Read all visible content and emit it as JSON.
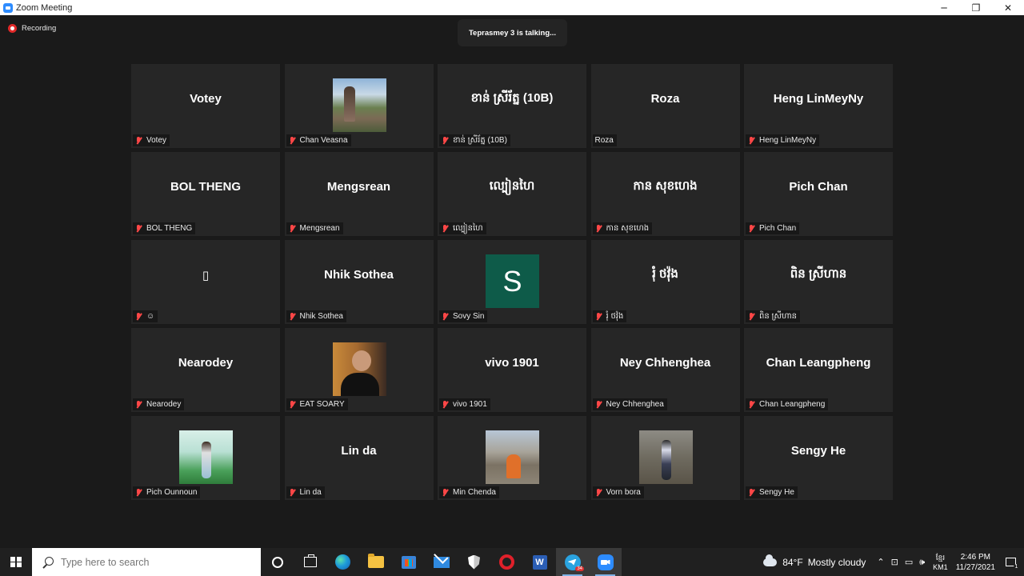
{
  "window": {
    "title": "Zoom Meeting",
    "minimize": "─",
    "restore": "❐",
    "close": "✕"
  },
  "meeting": {
    "recording_label": "Recording",
    "talking_indicator": "Teprasmey 3 is talking..."
  },
  "participants": [
    {
      "display": "Votey",
      "label": "Votey",
      "muted": true,
      "tile": "name"
    },
    {
      "display": "",
      "label": "Chan Veasna",
      "muted": true,
      "tile": "photo-1"
    },
    {
      "display": "ខាន់ ស្រីរ័ត្ន (10B)",
      "label": "ខាន់ ស្រីរ័ត្ន (10B)",
      "muted": true,
      "tile": "name"
    },
    {
      "display": "Roza",
      "label": "Roza",
      "muted": false,
      "tile": "name"
    },
    {
      "display": "Heng LinMeyNy",
      "label": "Heng LinMeyNy",
      "muted": true,
      "tile": "name"
    },
    {
      "display": "BOL THENG",
      "label": "BOL THENG",
      "muted": true,
      "tile": "name"
    },
    {
      "display": "Mengsrean",
      "label": "Mengsrean",
      "muted": true,
      "tile": "name"
    },
    {
      "display": "ល្បៀនហៃ",
      "label": "ល្បៀនហៃ",
      "muted": true,
      "tile": "name"
    },
    {
      "display": "កាន សុខហេង",
      "label": "កាន សុខហេង",
      "muted": true,
      "tile": "name"
    },
    {
      "display": "Pich Chan",
      "label": "Pich Chan",
      "muted": true,
      "tile": "name"
    },
    {
      "display": "▯",
      "label": "☺",
      "muted": true,
      "tile": "name"
    },
    {
      "display": "Nhik Sothea",
      "label": "Nhik Sothea",
      "muted": true,
      "tile": "name"
    },
    {
      "display": "S",
      "label": "Sovy Sin",
      "muted": true,
      "tile": "initial"
    },
    {
      "display": "រុំ ថវ៉ុង",
      "label": "រុំ ថវ៉ុង",
      "muted": true,
      "tile": "name"
    },
    {
      "display": "ពិន ស្រីហាន",
      "label": "ពិន ស្រីហាន",
      "muted": true,
      "tile": "name"
    },
    {
      "display": "Nearodey",
      "label": "Nearodey",
      "muted": true,
      "tile": "name"
    },
    {
      "display": "",
      "label": "EAT SOARY",
      "muted": true,
      "tile": "photo-2"
    },
    {
      "display": "vivo 1901",
      "label": "vivo 1901",
      "muted": true,
      "tile": "name"
    },
    {
      "display": "Ney Chhenghea",
      "label": "Ney Chhenghea",
      "muted": true,
      "tile": "name"
    },
    {
      "display": "Chan Leangpheng",
      "label": "Chan Leangpheng",
      "muted": true,
      "tile": "name"
    },
    {
      "display": "",
      "label": "Pich Ounnoun",
      "muted": true,
      "tile": "photo-3"
    },
    {
      "display": "Lin da",
      "label": "Lin da",
      "muted": true,
      "tile": "name"
    },
    {
      "display": "",
      "label": "Min Chenda",
      "muted": true,
      "tile": "photo-4"
    },
    {
      "display": "",
      "label": "Vorn bora",
      "muted": true,
      "tile": "photo-5"
    },
    {
      "display": "Sengy He",
      "label": "Sengy He",
      "muted": true,
      "tile": "name"
    }
  ],
  "taskbar": {
    "search_placeholder": "Type here to search",
    "word_label": "W",
    "telegram_badge": "34",
    "weather_temp": "84°F",
    "weather_text": "Mostly cloudy",
    "tray_chevron": "⌃",
    "lang_top": "ខ្មែរ",
    "lang_bottom": "KM1",
    "time": "2:46 PM",
    "date": "11/27/2021"
  }
}
